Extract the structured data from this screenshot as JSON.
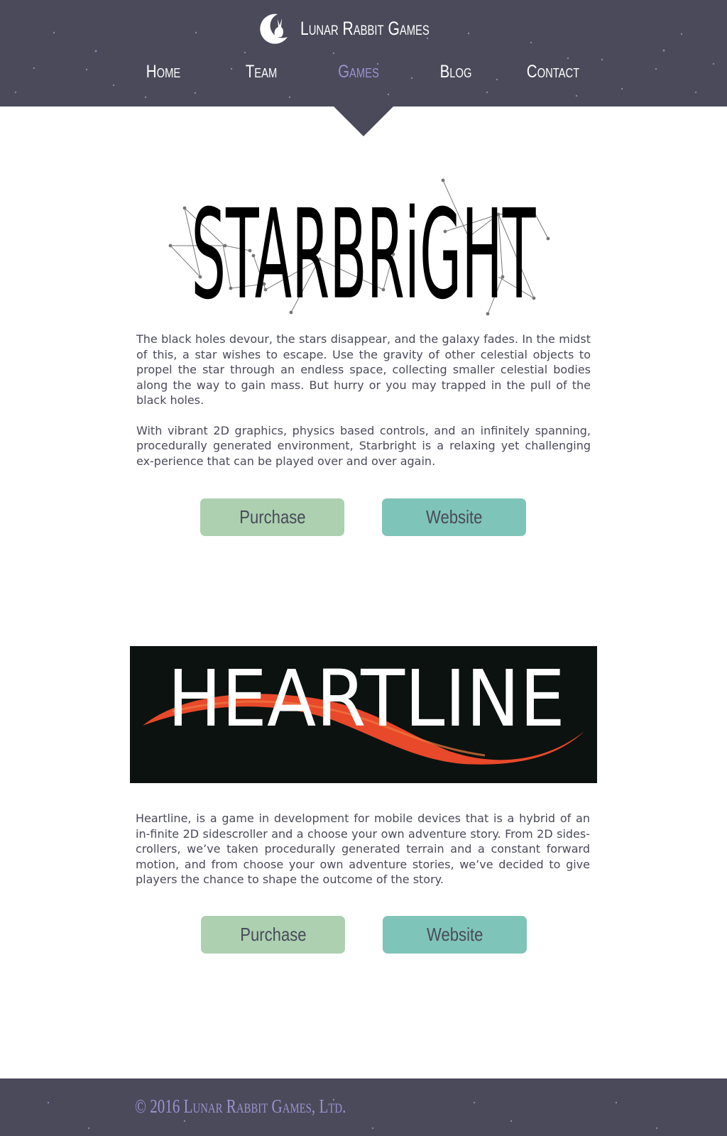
{
  "header": {
    "brand_name": "Lunar Rabbit Games",
    "nav": [
      {
        "label": "Home",
        "active": false
      },
      {
        "label": "Team",
        "active": false
      },
      {
        "label": "Games",
        "active": true
      },
      {
        "label": "Blog",
        "active": false
      },
      {
        "label": "Contact",
        "active": false
      }
    ]
  },
  "games": [
    {
      "logo_text": "STARBRiGHT",
      "paragraphs": [
        "The black holes devour, the stars disappear, and the galaxy fades. In the midst of this, a star wishes to escape. Use the gravity of other celestial objects to propel the star through an endless space, collecting smaller celestial bodies along the way to gain mass. But hurry or you may trapped in the pull of the black holes.",
        "With vibrant 2D graphics, physics based controls, and an infinitely spanning, procedurally generated environment, Starbright is a relaxing yet challenging ex-perience that can be played over and over again."
      ],
      "purchase_label": "Purchase",
      "website_label": "Website"
    },
    {
      "logo_text": "HEARTLINE",
      "paragraphs": [
        "Heartline,  is a game in development for mobile devices that is a hybrid of an in-finite 2D sidescroller and a choose your own adventure story. From 2D sides-crollers, we’ve taken procedurally generated terrain and a constant forward motion, and from choose your own adventure stories, we’ve decided to give players the chance to shape the outcome of the story."
      ],
      "purchase_label": "Purchase",
      "website_label": "Website"
    }
  ],
  "footer": {
    "copyright": "© 2016 Lunar Rabbit Games, Ltd."
  },
  "colors": {
    "header_bg": "#4b4a5a",
    "nav_active": "#9b90d0",
    "purchase_bg": "#acd0b0",
    "website_bg": "#7fc4b8",
    "heartline_accent": "#e8492a"
  }
}
